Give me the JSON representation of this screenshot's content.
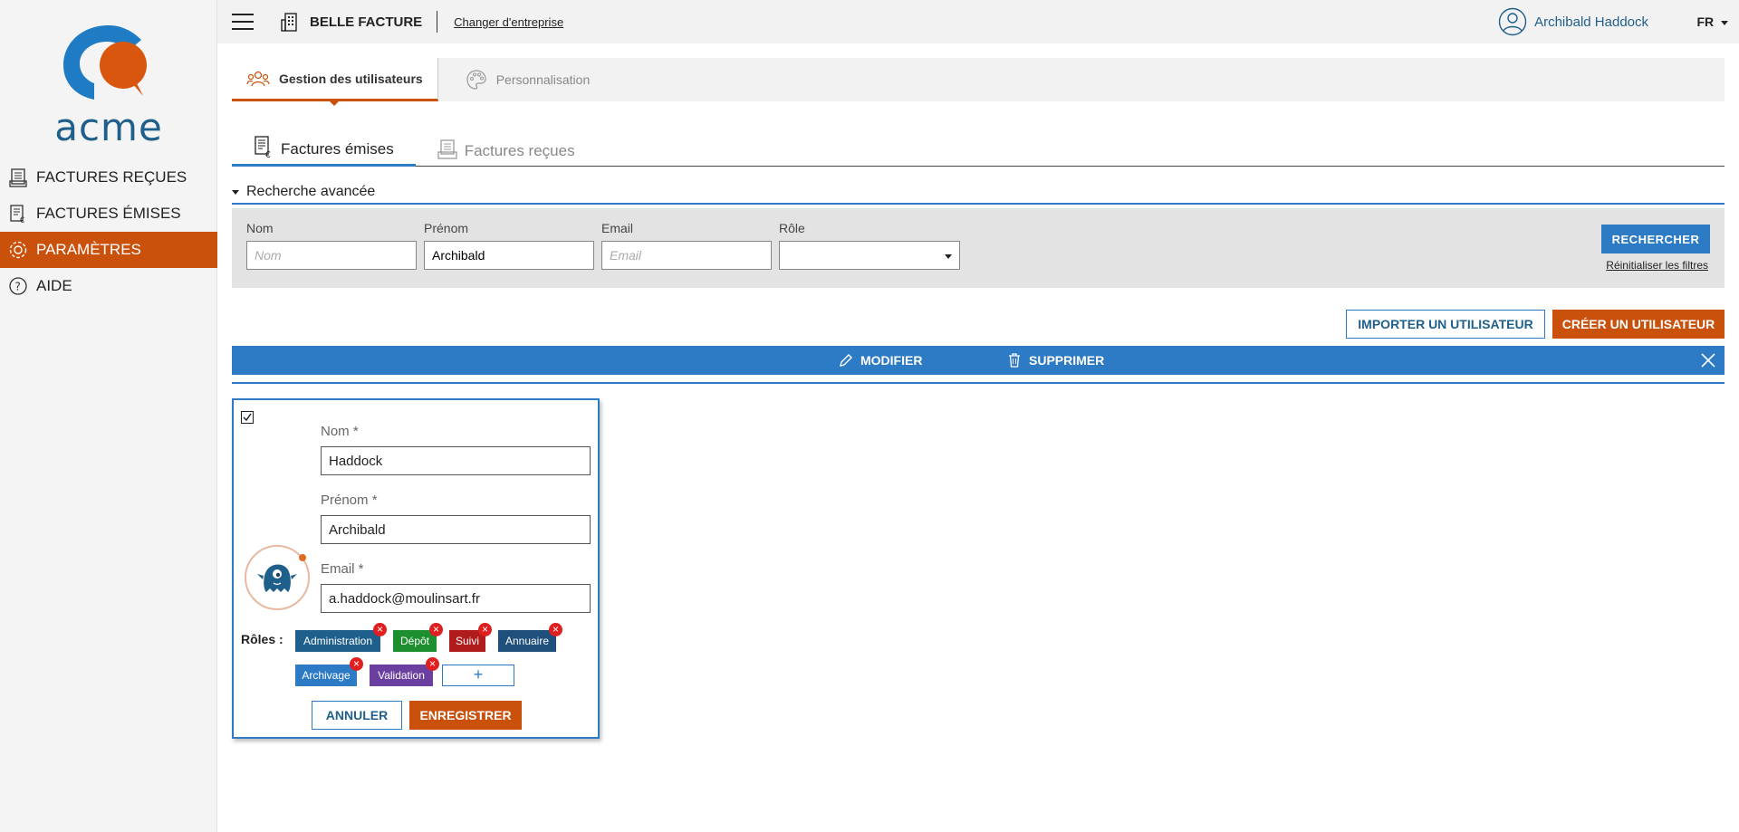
{
  "sidebar": {
    "logo_text": "acme",
    "items": [
      {
        "label": "FACTURES REÇUES",
        "icon": "received-invoices-icon",
        "active": false
      },
      {
        "label": "FACTURES ÉMISES",
        "icon": "issued-invoices-icon",
        "active": false
      },
      {
        "label": "PARAMÈTRES",
        "icon": "gear-icon",
        "active": true
      },
      {
        "label": "AIDE",
        "icon": "help-icon",
        "active": false
      }
    ]
  },
  "topbar": {
    "company": "BELLE FACTURE",
    "change_company": "Changer d'entreprise",
    "user_name": "Archibald Haddock",
    "language": "FR"
  },
  "main_tabs": [
    {
      "label": "Gestion des utilisateurs",
      "icon": "users-icon",
      "active": true
    },
    {
      "label": "Personnalisation",
      "icon": "palette-icon",
      "active": false
    }
  ],
  "sub_tabs": [
    {
      "label": "Factures émises",
      "icon": "issued-invoices-icon",
      "active": true
    },
    {
      "label": "Factures reçues",
      "icon": "received-invoices-icon",
      "active": false
    }
  ],
  "search": {
    "title": "Recherche avancée",
    "nom_label": "Nom",
    "nom_placeholder": "Nom",
    "nom_value": "",
    "prenom_label": "Prénom",
    "prenom_value": "Archibald",
    "email_label": "Email",
    "email_placeholder": "Email",
    "email_value": "",
    "role_label": "Rôle",
    "role_value": "",
    "search_button": "RECHERCHER",
    "reset_link": "Réinitialiser les filtres"
  },
  "actions": {
    "import_button": "IMPORTER UN UTILISATEUR",
    "create_button": "CRÉER UN UTILISATEUR"
  },
  "action_bar": {
    "modify": "MODIFIER",
    "delete": "SUPPRIMER"
  },
  "user_card": {
    "nom_label": "Nom *",
    "nom_value": "Haddock",
    "prenom_label": "Prénom *",
    "prenom_value": "Archibald",
    "email_label": "Email *",
    "email_value": "a.haddock@moulinsart.fr",
    "roles_label": "Rôles :",
    "roles": [
      {
        "label": "Administration",
        "color": "#1f5f8b"
      },
      {
        "label": "Dépôt",
        "color": "#1e8f2e"
      },
      {
        "label": "Suivi",
        "color": "#b01c1c"
      },
      {
        "label": "Annuaire",
        "color": "#1f4f7b"
      },
      {
        "label": "Archivage",
        "color": "#2d7bc4"
      },
      {
        "label": "Validation",
        "color": "#6b3fa0"
      }
    ],
    "add_role": "+",
    "cancel_button": "ANNULER",
    "save_button": "ENREGISTRER"
  },
  "colors": {
    "primary": "#2d7bc4",
    "accent": "#c9510c",
    "brand_blue": "#1f5f8b"
  }
}
